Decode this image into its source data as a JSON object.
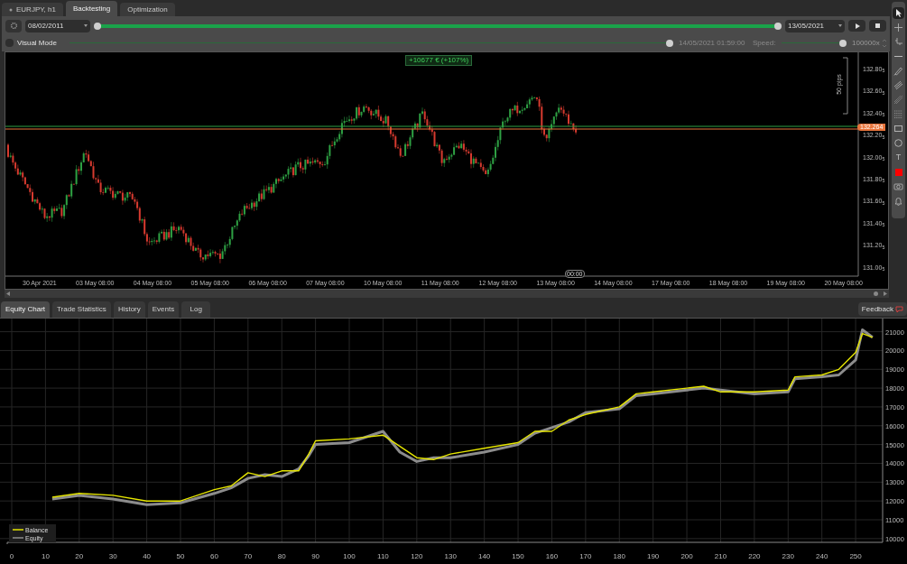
{
  "tabs": [
    {
      "label": "EURJPY, h1",
      "selected": false,
      "kind": "chart"
    },
    {
      "label": "Backtesting",
      "selected": true,
      "kind": "plain"
    },
    {
      "label": "Optimization",
      "selected": false,
      "kind": "plain"
    }
  ],
  "period": {
    "start_date": "08/02/2011",
    "end_date": "13/05/2021",
    "level": 1
  },
  "visual_mode": {
    "label": "Visual Mode",
    "checked": false
  },
  "playback": {
    "time": "14/05/2021 01:59:00",
    "level": 1
  },
  "speed": {
    "label": "Speed:",
    "value": "100000x",
    "level": 1
  },
  "chart": {
    "profit": "+10677 € (+107%)",
    "current_price": "132.264",
    "ruler": "50 pips",
    "cursor_time": "00:00",
    "price_labels": [
      "132.80$_{5}$",
      "132.60$_{5}$",
      "132.40$_{5}$",
      "132.20$_{5}$",
      "132.00$_{5}$",
      "131.80$_{5}$",
      "131.60$_{5}$",
      "131.40$_{5}$",
      "131.20$_{5}$",
      "131.00$_{5}$"
    ],
    "time_labels": [
      "30 Apr 2021",
      "03 May 08:00",
      "04 May 08:00",
      "05 May 08:00",
      "06 May 08:00",
      "07 May 08:00",
      "10 May 08:00",
      "11 May 08:00",
      "12 May 08:00",
      "13 May 08:00",
      "14 May 08:00",
      "17 May 08:00",
      "18 May 08:00",
      "19 May 08:00",
      "20 May 08:00"
    ]
  },
  "tools": [
    {
      "kind": "pointer",
      "selected": true
    },
    {
      "kind": "crosshair",
      "selected": false
    },
    {
      "kind": "ruler",
      "selected": false
    },
    {
      "kind": "line",
      "selected": false
    },
    {
      "kind": "pen",
      "selected": false
    },
    {
      "kind": "channel",
      "selected": false
    },
    {
      "kind": "pitchfork",
      "selected": false
    },
    {
      "kind": "fibonacci",
      "selected": false
    },
    {
      "kind": "rectangle",
      "selected": false
    },
    {
      "kind": "ellipse",
      "selected": false
    },
    {
      "kind": "text",
      "glyph": "T",
      "selected": false
    },
    {
      "kind": "color",
      "color": "#ff0000",
      "selected": false
    },
    {
      "kind": "camera",
      "selected": false
    },
    {
      "kind": "bell",
      "selected": false
    }
  ],
  "bottom_tabs": [
    {
      "label": "Equity Chart",
      "selected": true
    },
    {
      "label": "Trade Statistics",
      "selected": false
    },
    {
      "label": "History",
      "selected": false
    },
    {
      "label": "Events",
      "selected": false
    },
    {
      "label": "Log",
      "selected": false
    }
  ],
  "feedback": "Feedback",
  "equity": {
    "chart_data": {
      "type": "line",
      "x": [
        12,
        20,
        30,
        40,
        50,
        60,
        65,
        70,
        75,
        80,
        85,
        88,
        90,
        100,
        110,
        115,
        120,
        125,
        130,
        140,
        150,
        155,
        160,
        165,
        170,
        180,
        185,
        190,
        200,
        205,
        210,
        220,
        230,
        232,
        240,
        245,
        250,
        252,
        255
      ],
      "series": [
        {
          "name": "Balance",
          "color": "#e6e600",
          "values": [
            12200,
            12400,
            12300,
            12000,
            12000,
            12600,
            12800,
            13500,
            13300,
            13600,
            13600,
            14500,
            15200,
            15300,
            15500,
            14900,
            14300,
            14200,
            14500,
            14800,
            15100,
            15700,
            15700,
            16300,
            16600,
            17000,
            17700,
            17800,
            18000,
            18100,
            17800,
            17800,
            17900,
            18600,
            18700,
            19000,
            19900,
            20900,
            20700
          ]
        },
        {
          "name": "Equity",
          "color": "#8c8c8c",
          "values": [
            12100,
            12300,
            12100,
            11800,
            11900,
            12400,
            12700,
            13200,
            13400,
            13300,
            13700,
            14400,
            15000,
            15100,
            15700,
            14600,
            14100,
            14300,
            14300,
            14600,
            15000,
            15600,
            15900,
            16200,
            16700,
            16900,
            17600,
            17700,
            17900,
            18000,
            17900,
            17700,
            17800,
            18500,
            18600,
            18700,
            19500,
            21100,
            20700
          ]
        }
      ],
      "xlim": [
        0,
        258
      ],
      "ylim": [
        9800,
        21700
      ],
      "grid": true,
      "legend": "lower left",
      "xticks": [
        0,
        10,
        20,
        30,
        40,
        50,
        60,
        70,
        80,
        90,
        100,
        110,
        120,
        130,
        140,
        150,
        160,
        170,
        180,
        190,
        200,
        210,
        220,
        230,
        240,
        250
      ],
      "yticks": [
        10000,
        11000,
        12000,
        13000,
        14000,
        15000,
        16000,
        17000,
        18000,
        19000,
        20000,
        21000
      ]
    }
  }
}
